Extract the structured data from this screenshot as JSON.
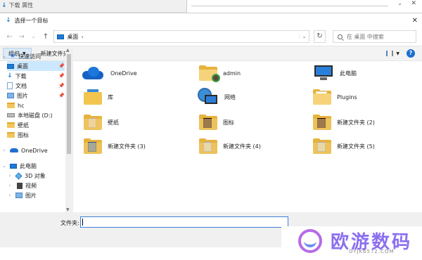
{
  "background_window": {
    "title": "下载 属性"
  },
  "dialog": {
    "title": "选择一个目标",
    "address": {
      "crumb": "桌面",
      "separator": "›"
    },
    "search_placeholder": "在 桌面 中搜索"
  },
  "toolbar": {
    "organize": "组织",
    "new_folder": "新建文件夹"
  },
  "nav": {
    "items": [
      {
        "label": "快速访问",
        "icon": "star-icon"
      },
      {
        "label": "桌面",
        "icon": "desktop-icon",
        "pinned": true,
        "selected": true
      },
      {
        "label": "下载",
        "icon": "download-icon",
        "pinned": true
      },
      {
        "label": "文档",
        "icon": "document-icon",
        "pinned": true
      },
      {
        "label": "图片",
        "icon": "pictures-icon",
        "pinned": true
      },
      {
        "label": "hc",
        "icon": "folder-icon"
      },
      {
        "label": "本地磁盘 (D:)",
        "icon": "drive-icon"
      },
      {
        "label": "壁纸",
        "icon": "folder-icon"
      },
      {
        "label": "图标",
        "icon": "folder-icon"
      },
      {
        "label": "OneDrive",
        "icon": "onedrive-icon"
      },
      {
        "label": "此电脑",
        "icon": "computer-icon"
      },
      {
        "label": "3D 对象",
        "icon": "3d-objects-icon"
      },
      {
        "label": "视频",
        "icon": "video-icon"
      },
      {
        "label": "图片",
        "icon": "pictures-icon"
      }
    ]
  },
  "items": [
    {
      "label": "OneDrive",
      "icon": "onedrive-icon"
    },
    {
      "label": "admin",
      "icon": "user-folder-icon"
    },
    {
      "label": "此电脑",
      "icon": "computer-icon"
    },
    {
      "label": "库",
      "icon": "library-icon"
    },
    {
      "label": "网络",
      "icon": "network-icon"
    },
    {
      "label": "Plugins",
      "icon": "folder-icon"
    },
    {
      "label": "壁纸",
      "icon": "folder-icon"
    },
    {
      "label": "图标",
      "icon": "folder-icon"
    },
    {
      "label": "新建文件夹 (2)",
      "icon": "folder-icon"
    },
    {
      "label": "新建文件夹 (3)",
      "icon": "folder-icon"
    },
    {
      "label": "新建文件夹 (4)",
      "icon": "folder-icon"
    },
    {
      "label": "新建文件夹 (5)",
      "icon": "folder-icon"
    }
  ],
  "bottom": {
    "folder_label": "文件夹:",
    "folder_value": ""
  },
  "watermark": {
    "name": "欧游数码",
    "url": "OYJK6572.COM"
  }
}
